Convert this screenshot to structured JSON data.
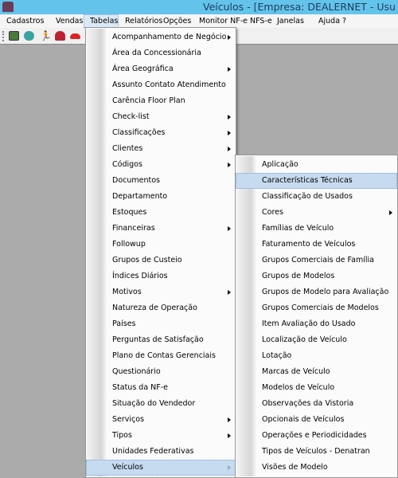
{
  "window": {
    "title": "Veículos - [Empresa: DEALERNET - Usu"
  },
  "menubar": [
    {
      "label": "Cadastros"
    },
    {
      "label": "Vendas"
    },
    {
      "label": "Tabelas",
      "active": true
    },
    {
      "label": "Relatórios"
    },
    {
      "label": "Opções"
    },
    {
      "label": "Monitor NF-e NFS-e"
    },
    {
      "label": "Janelas"
    },
    {
      "label": "Ajuda ?"
    }
  ],
  "toolbar": {
    "icons": [
      "grid-icon",
      "car-search-icon",
      "runner-icon",
      "cat-icon",
      "red-car-icon"
    ]
  },
  "tabelas_menu": [
    {
      "label": "Acompanhamento de Negócio",
      "sub": true
    },
    {
      "label": "Área da Concessionária"
    },
    {
      "label": "Área Geográfica",
      "sub": true
    },
    {
      "label": "Assunto Contato Atendimento"
    },
    {
      "label": "Carência Floor Plan"
    },
    {
      "label": "Check-list",
      "sub": true
    },
    {
      "label": "Classificações",
      "sub": true
    },
    {
      "label": "Clientes",
      "sub": true
    },
    {
      "label": "Códigos",
      "sub": true
    },
    {
      "label": "Documentos"
    },
    {
      "label": "Departamento"
    },
    {
      "label": "Estoques"
    },
    {
      "label": "Financeiras",
      "sub": true
    },
    {
      "label": "Followup"
    },
    {
      "label": "Grupos de Custeio"
    },
    {
      "label": "Índices Diários"
    },
    {
      "label": "Motivos",
      "sub": true
    },
    {
      "label": "Natureza de Operação"
    },
    {
      "label": "Países"
    },
    {
      "label": "Perguntas de Satisfação"
    },
    {
      "label": "Plano de Contas Gerenciais"
    },
    {
      "label": "Questionário"
    },
    {
      "label": "Status da NF-e"
    },
    {
      "label": "Situação do Vendedor"
    },
    {
      "label": "Serviços",
      "sub": true
    },
    {
      "label": "Tipos",
      "sub": true
    },
    {
      "label": "Unidades Federativas"
    },
    {
      "label": "Veículos",
      "sub": true,
      "highlighted": true
    }
  ],
  "veiculos_menu": [
    {
      "label": "Aplicação"
    },
    {
      "label": "Características Técnicas",
      "highlighted": true
    },
    {
      "label": "Classificação de Usados"
    },
    {
      "label": "Cores",
      "sub": true
    },
    {
      "label": "Famílias de Veículo"
    },
    {
      "label": "Faturamento de Veículos"
    },
    {
      "label": "Grupos Comerciais de Família"
    },
    {
      "label": "Grupos de Modelos"
    },
    {
      "label": "Grupos de Modelo para Avaliação"
    },
    {
      "label": "Grupos Comerciais de Modelos"
    },
    {
      "label": "Item Avaliação do Usado"
    },
    {
      "label": "Localização de Veículo"
    },
    {
      "label": "Lotação"
    },
    {
      "label": "Marcas de Veículo"
    },
    {
      "label": "Modelos de Veículo"
    },
    {
      "label": "Observações da Vistoria"
    },
    {
      "label": "Opcionais de Veículos"
    },
    {
      "label": "Operações e Periodicidades"
    },
    {
      "label": "Tipos de Veículos - Denatran"
    },
    {
      "label": "Visões de Modelo"
    }
  ]
}
